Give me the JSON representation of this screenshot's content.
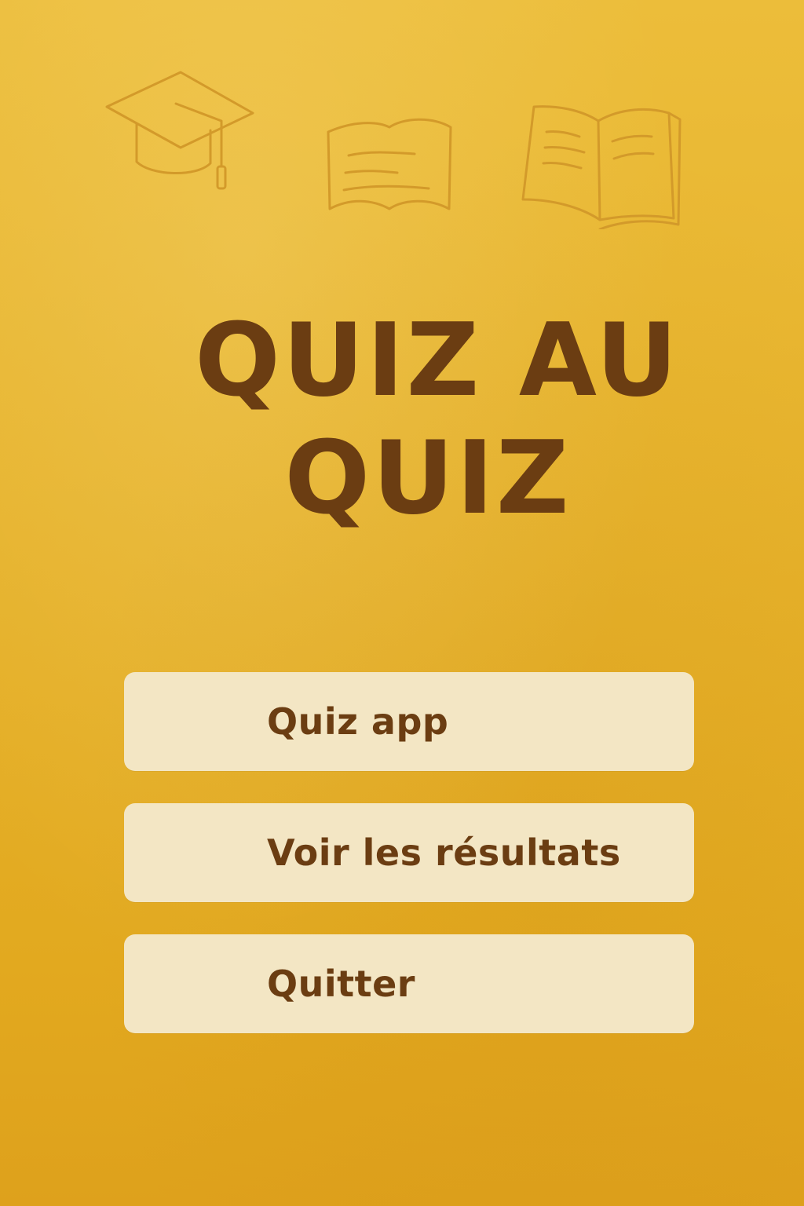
{
  "app": {
    "title_line1": "QUIZ AU",
    "title_line2": "QUIZ"
  },
  "decor": {
    "icons": [
      "graduation-cap-icon",
      "closed-book-icon",
      "open-book-icon"
    ],
    "stroke_color": "#d39a2a"
  },
  "menu": {
    "quiz_label": "Quiz app",
    "results_label": "Voir les résultats",
    "quit_label": "Quitter"
  },
  "colors": {
    "background_top": "#ecbd3a",
    "background_bottom": "#dea11c",
    "title_text": "#6b3d12",
    "button_bg": "#f3e6c4",
    "button_text": "#6b3d12"
  }
}
